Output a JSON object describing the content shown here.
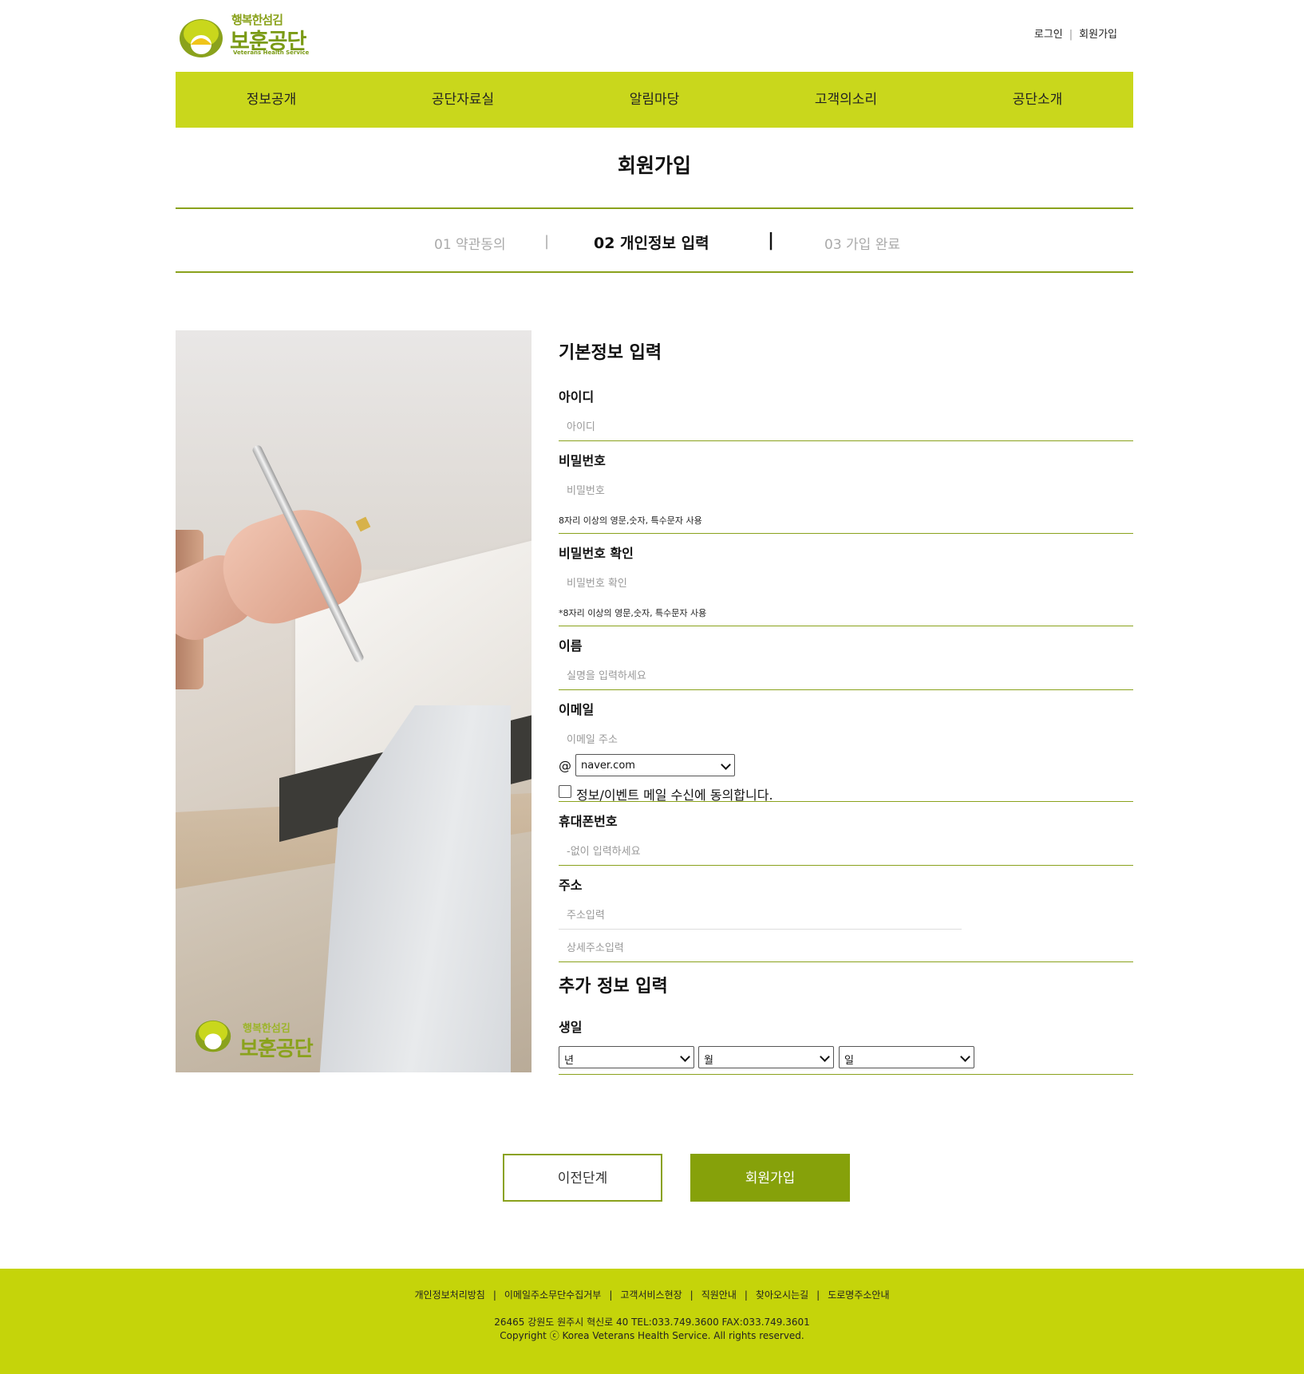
{
  "header": {
    "logo_sub": "행복한섬김",
    "logo_main": "보훈공단",
    "logo_en": "Veterans Health Service",
    "login_label": "로그인",
    "join_label": "회원가입"
  },
  "nav": {
    "items": [
      "정보공개",
      "공단자료실",
      "알림마당",
      "고객의소리",
      "공단소개"
    ]
  },
  "page_title": "회원가입",
  "steps": {
    "step1": "01 약관동의",
    "step2": "02 개인정보 입력",
    "step3": "03 가입 완료",
    "sep": "|"
  },
  "form": {
    "basic_title": "기본정보 입력",
    "id_label": "아이디",
    "id_placeholder": "아이디",
    "pw_label": "비밀번호",
    "pw_placeholder": "비밀번호",
    "pw_note": "8자리 이상의 영문,숫자, 특수문자 사용",
    "pw2_label": "비밀번호 확인",
    "pw2_placeholder": "비밀번호 확인",
    "pw2_note": "*8자리 이상의 영문,숫자, 특수문자 사용",
    "name_label": "이름",
    "name_placeholder": "실명을 입력하세요",
    "email_label": "이메일",
    "email_placeholder": "이메일 주소",
    "email_at": "@",
    "email_domain": "naver.com",
    "email_agree": "정보/이벤트 메일 수신에 동의합니다.",
    "phone_label": "휴대폰번호",
    "phone_placeholder": "-없이 입력하세요",
    "addr_label": "주소",
    "addr_placeholder": "주소입력",
    "addr_detail_placeholder": "상세주소입력",
    "extra_title": "추가 정보 입력",
    "birth_label": "생일",
    "birth_year": "년",
    "birth_month": "월",
    "birth_day": "일"
  },
  "buttons": {
    "prev": "이전단계",
    "join": "회원가입"
  },
  "footer": {
    "links": [
      "개인정보처리방침",
      "이메일주소무단수집거부",
      "고객서비스현장",
      "직원안내",
      "찾아오시는길",
      "도로명주소안내"
    ],
    "link_sep": "|",
    "address": "26465 강원도 원주시 혁신로 40 TEL:033.749.3600 FAX:033.749.3601",
    "copyright": "Copyright ⓒ Korea Veterans Health Service. All rights reserved."
  },
  "colors": {
    "nav_bg": "#c9d71c",
    "accent_line": "#8aa21c",
    "join_button": "#86a10a",
    "footer_bg": "#c5d40a"
  }
}
